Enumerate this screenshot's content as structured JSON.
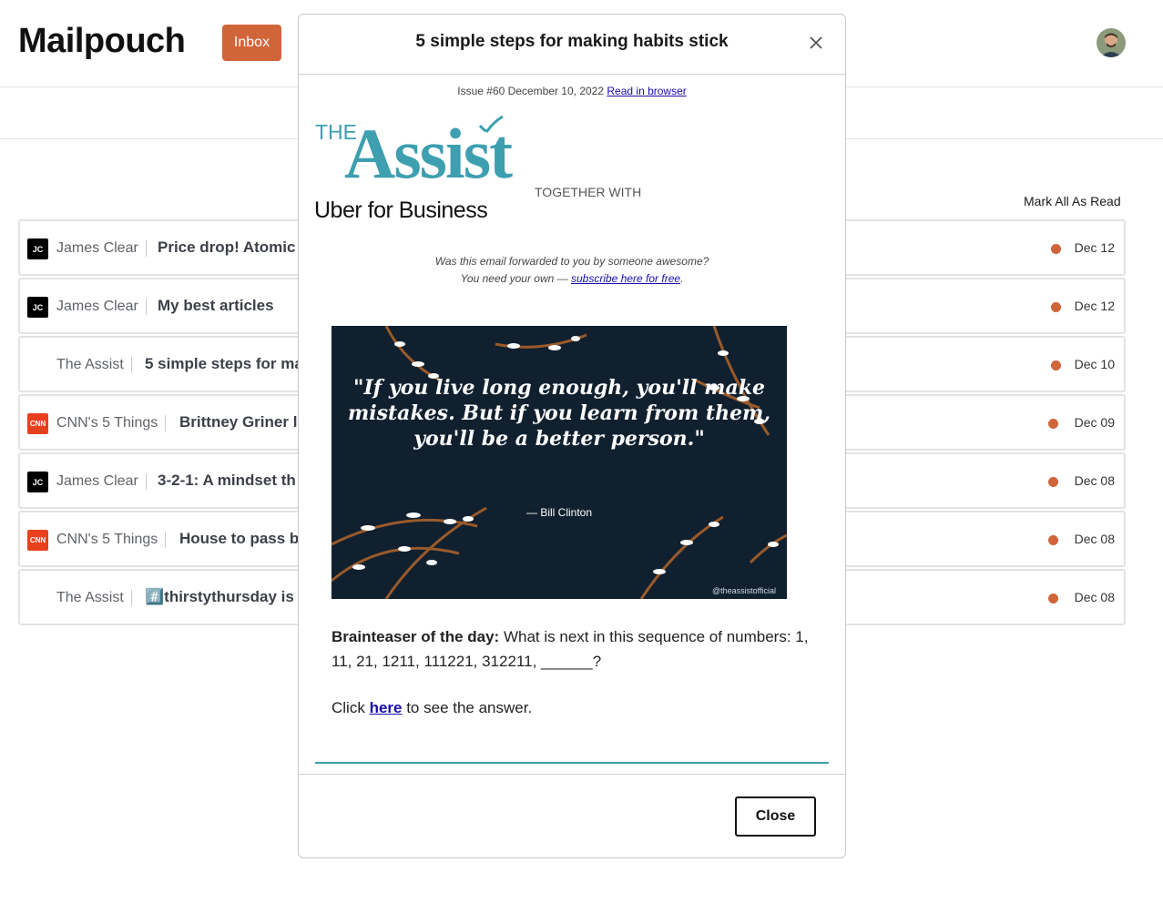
{
  "app": {
    "brand": "Mailpouch",
    "inbox_label": "Inbox",
    "mark_all_read": "Mark All As Read"
  },
  "emails": [
    {
      "sender": "James Clear",
      "subject": "Price drop! Atomic",
      "date": "Dec 12",
      "icon": "jc-logo-icon",
      "icon_text": "JC",
      "unread": true
    },
    {
      "sender": "James Clear",
      "subject": "My best articles",
      "date": "Dec 12",
      "icon": "jc-logo-icon",
      "icon_text": "JC",
      "unread": true
    },
    {
      "sender": "The Assist",
      "subject": "5 simple steps for ma",
      "date": "Dec 10",
      "icon": "none",
      "icon_text": "",
      "unread": true
    },
    {
      "sender": "CNN's 5 Things",
      "subject": "Brittney Griner la",
      "date": "Dec 09",
      "icon": "cnn-logo-icon",
      "icon_text": "CNN",
      "unread": true
    },
    {
      "sender": "James Clear",
      "subject": "3-2-1: A mindset th",
      "date": "Dec 08",
      "icon": "jc-logo-icon",
      "icon_text": "JC",
      "unread": true
    },
    {
      "sender": "CNN's 5 Things",
      "subject": "House to pass bi",
      "date": "Dec 08",
      "icon": "cnn-logo-icon",
      "icon_text": "CNN",
      "unread": true
    },
    {
      "sender": "The Assist",
      "subject": "#️⃣thirstythursday is I",
      "date": "Dec 08",
      "icon": "none",
      "icon_text": "",
      "unread": true
    }
  ],
  "modal": {
    "title": "5 simple steps for making habits stick",
    "issue_text": "Issue #60 December 10, 2022",
    "read_in_browser": "Read in browser",
    "logo_the": "THE",
    "logo_assist": "Assist",
    "logo_together": "TOGETHER WITH",
    "logo_uber": "Uber for Business",
    "forward_line1": "Was this email forwarded to you by someone awesome?",
    "forward_line2_prefix": "You need your own — ",
    "forward_link": "subscribe here for free",
    "forward_line2_suffix": ".",
    "quote": "\"If you live long enough, you'll make mistakes. But if you learn from them, you'll be a better person.\"",
    "quote_author": "— Bill Clinton",
    "quote_handle": "@theassistofficial",
    "brainteaser_label": "Brainteaser of the day:",
    "brainteaser_text": " What is next in this sequence of numbers: 1, 11, 21, 1211, 111221, 312211, ______?",
    "click_prefix": "Click ",
    "click_link": "here",
    "click_suffix": " to see the answer.",
    "close_label": "Close"
  },
  "colors": {
    "accent": "#d0653a",
    "teal": "#3d9fb0",
    "quote_bg": "#10202f"
  }
}
